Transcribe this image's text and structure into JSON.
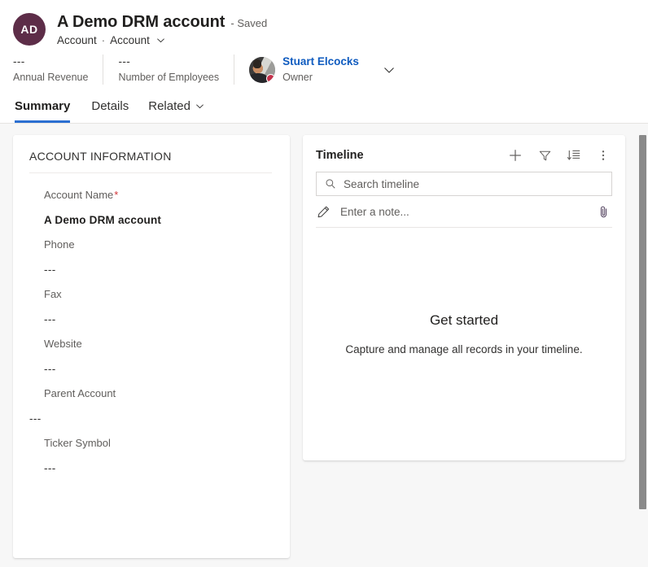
{
  "header": {
    "avatar_initials": "AD",
    "avatar_color": "#5d2d48",
    "title": "A Demo DRM account",
    "saved_status": "- Saved",
    "entity_type": "Account",
    "separator": "·",
    "form_name": "Account",
    "stats": [
      {
        "value": "---",
        "label": "Annual Revenue"
      },
      {
        "value": "---",
        "label": "Number of Employees"
      }
    ],
    "owner": {
      "name": "Stuart Elcocks",
      "role": "Owner",
      "presence_color": "#c4314b"
    }
  },
  "tabs": [
    {
      "label": "Summary",
      "active": true,
      "has_chevron": false
    },
    {
      "label": "Details",
      "active": false,
      "has_chevron": false
    },
    {
      "label": "Related",
      "active": false,
      "has_chevron": true
    }
  ],
  "account_card": {
    "section_title": "ACCOUNT INFORMATION",
    "fields": [
      {
        "label": "Account Name",
        "required": true,
        "value": "A Demo DRM account",
        "bold": true
      },
      {
        "label": "Phone",
        "required": false,
        "value": "---",
        "bold": false
      },
      {
        "label": "Fax",
        "required": false,
        "value": "---",
        "bold": false
      },
      {
        "label": "Website",
        "required": false,
        "value": "---",
        "bold": false
      },
      {
        "label": "Parent Account",
        "required": false,
        "value": "---",
        "bold": false
      },
      {
        "label": "Ticker Symbol",
        "required": false,
        "value": "---",
        "bold": false
      }
    ]
  },
  "timeline": {
    "title": "Timeline",
    "actions": [
      {
        "name": "create-timeline-record-icon",
        "label": "Create a timeline record"
      },
      {
        "name": "filter-icon",
        "label": "Filter timeline"
      },
      {
        "name": "sort-icon",
        "label": "Sort timeline"
      },
      {
        "name": "more-commands-icon",
        "label": "More commands"
      }
    ],
    "search_placeholder": "Search timeline",
    "note_placeholder": "Enter a note...",
    "attach_icon_label": "Add attachment",
    "empty_title": "Get started",
    "empty_subtitle": "Capture and manage all records in your timeline."
  },
  "theme": {
    "accent": "#2b6fd1",
    "link": "#0f5bbf",
    "required_red": "#d13438",
    "canvas_bg": "#f7f7f7"
  }
}
